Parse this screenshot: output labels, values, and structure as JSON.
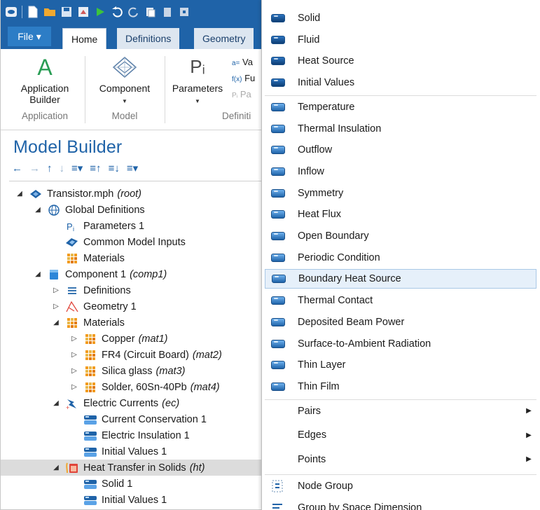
{
  "ribbon": {
    "file_label": "File ▾",
    "tabs": [
      {
        "label": "Home"
      },
      {
        "label": "Definitions"
      },
      {
        "label": "Geometry"
      }
    ],
    "groups": {
      "application": {
        "button": "Application\nBuilder",
        "caption": "Application",
        "icon": "A"
      },
      "model": {
        "button": "Component",
        "caption": "Model",
        "icon": "component-icon"
      },
      "definitions": {
        "button": "Parameters",
        "caption": "Definiti",
        "icon": "Pᵢ",
        "items": [
          "Va",
          "Fu",
          "Pa"
        ],
        "item_prefixes": [
          "a=",
          "f(x)",
          "Pᵢ"
        ]
      }
    }
  },
  "model_builder": {
    "title": "Model Builder",
    "tree": [
      {
        "label": "Transistor.mph",
        "tag": "(root)",
        "depth": 0,
        "toggle": "open",
        "icon": "model-icon"
      },
      {
        "label": "Global Definitions",
        "tag": "",
        "depth": 1,
        "toggle": "open",
        "icon": "globe-icon"
      },
      {
        "label": "Parameters 1",
        "tag": "",
        "depth": 2,
        "toggle": "",
        "icon": "parameters-icon"
      },
      {
        "label": "Common Model Inputs",
        "tag": "",
        "depth": 2,
        "toggle": "",
        "icon": "common-inputs-icon"
      },
      {
        "label": "Materials",
        "tag": "",
        "depth": 2,
        "toggle": "",
        "icon": "materials-icon"
      },
      {
        "label": "Component 1",
        "tag": "(comp1)",
        "depth": 1,
        "toggle": "open",
        "icon": "component-icon"
      },
      {
        "label": "Definitions",
        "tag": "",
        "depth": 2,
        "toggle": "closed",
        "icon": "definitions-icon"
      },
      {
        "label": "Geometry 1",
        "tag": "",
        "depth": 2,
        "toggle": "closed",
        "icon": "geometry-icon"
      },
      {
        "label": "Materials",
        "tag": "",
        "depth": 2,
        "toggle": "open",
        "icon": "materials-icon"
      },
      {
        "label": "Copper",
        "tag": "(mat1)",
        "depth": 3,
        "toggle": "closed",
        "icon": "materials-icon"
      },
      {
        "label": "FR4 (Circuit Board)",
        "tag": "(mat2)",
        "depth": 3,
        "toggle": "closed",
        "icon": "materials-icon"
      },
      {
        "label": "Silica glass",
        "tag": "(mat3)",
        "depth": 3,
        "toggle": "closed",
        "icon": "materials-icon"
      },
      {
        "label": "Solder, 60Sn-40Pb",
        "tag": "(mat4)",
        "depth": 3,
        "toggle": "closed",
        "icon": "materials-icon"
      },
      {
        "label": "Electric Currents",
        "tag": "(ec)",
        "depth": 2,
        "toggle": "open",
        "icon": "electric-currents-icon"
      },
      {
        "label": "Current Conservation 1",
        "tag": "",
        "depth": 3,
        "toggle": "",
        "icon": "feature-icon"
      },
      {
        "label": "Electric Insulation 1",
        "tag": "",
        "depth": 3,
        "toggle": "",
        "icon": "feature-icon"
      },
      {
        "label": "Initial Values 1",
        "tag": "",
        "depth": 3,
        "toggle": "",
        "icon": "feature-icon"
      },
      {
        "label": "Heat Transfer in Solids",
        "tag": "(ht)",
        "depth": 2,
        "toggle": "open",
        "icon": "heat-transfer-icon",
        "selected": true
      },
      {
        "label": "Solid 1",
        "tag": "",
        "depth": 3,
        "toggle": "",
        "icon": "feature-icon"
      },
      {
        "label": "Initial Values 1",
        "tag": "",
        "depth": 3,
        "toggle": "",
        "icon": "feature-icon"
      }
    ]
  },
  "context_menu": {
    "items": [
      {
        "label": "Solid",
        "icon": "domain-feature-icon",
        "submenu": false
      },
      {
        "label": "Fluid",
        "icon": "domain-feature-icon",
        "submenu": false
      },
      {
        "label": "Heat Source",
        "icon": "domain-feature-icon",
        "submenu": false
      },
      {
        "label": "Initial Values",
        "icon": "domain-feature-icon",
        "submenu": false
      },
      {
        "label": "Temperature",
        "icon": "boundary-feature-icon",
        "submenu": false
      },
      {
        "label": "Thermal Insulation",
        "icon": "boundary-feature-icon",
        "submenu": false
      },
      {
        "label": "Outflow",
        "icon": "boundary-feature-icon",
        "submenu": false
      },
      {
        "label": "Inflow",
        "icon": "boundary-feature-icon",
        "submenu": false
      },
      {
        "label": "Symmetry",
        "icon": "boundary-feature-icon",
        "submenu": false
      },
      {
        "label": "Heat Flux",
        "icon": "boundary-feature-icon",
        "submenu": false
      },
      {
        "label": "Open Boundary",
        "icon": "boundary-feature-icon",
        "submenu": false
      },
      {
        "label": "Periodic Condition",
        "icon": "boundary-feature-icon",
        "submenu": false
      },
      {
        "label": "Boundary Heat Source",
        "icon": "boundary-feature-icon",
        "submenu": false,
        "highlighted": true
      },
      {
        "label": "Thermal Contact",
        "icon": "boundary-feature-icon",
        "submenu": false
      },
      {
        "label": "Deposited Beam Power",
        "icon": "boundary-feature-icon",
        "submenu": false
      },
      {
        "label": "Surface-to-Ambient Radiation",
        "icon": "boundary-feature-icon",
        "submenu": false
      },
      {
        "label": "Thin Layer",
        "icon": "boundary-feature-icon",
        "submenu": false
      },
      {
        "label": "Thin Film",
        "icon": "boundary-feature-icon",
        "submenu": false
      },
      {
        "label": "Pairs",
        "icon": "",
        "submenu": true
      },
      {
        "label": "Edges",
        "icon": "",
        "submenu": true
      },
      {
        "label": "Points",
        "icon": "",
        "submenu": true
      },
      {
        "label": "Node Group",
        "icon": "node-group-icon",
        "submenu": false
      },
      {
        "label": "Group by Space Dimension",
        "icon": "group-by-dimension-icon",
        "submenu": false
      }
    ]
  }
}
